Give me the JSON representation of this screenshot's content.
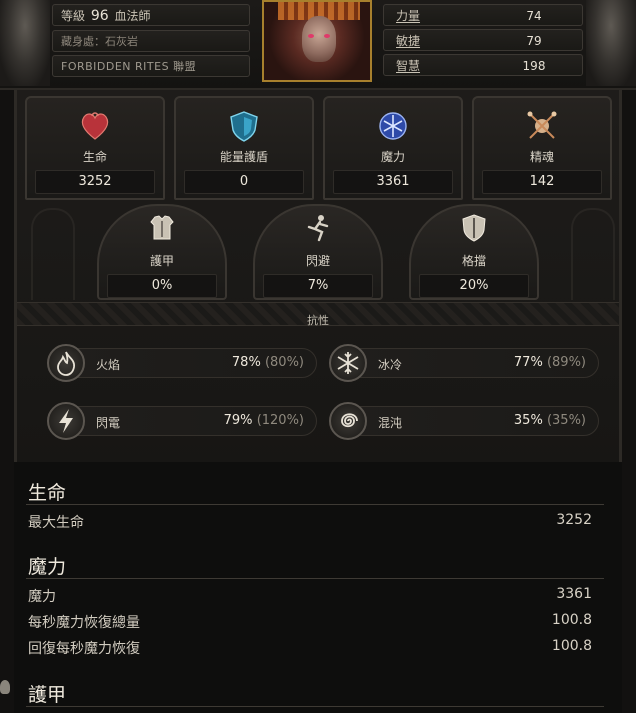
{
  "header": {
    "level_label": "等級",
    "level": "96",
    "class_name": "血法師",
    "stash": "藏身處：石灰岩",
    "guild_name": "FORBIDDEN RITES",
    "guild_suffix": "聯盟",
    "attributes": [
      {
        "label": "力量",
        "value": "74"
      },
      {
        "label": "敏捷",
        "value": "79"
      },
      {
        "label": "智慧",
        "value": "198"
      }
    ]
  },
  "core_stats": [
    {
      "icon": "heart-icon",
      "label": "生命",
      "value": "3252",
      "color": "#c4363a"
    },
    {
      "icon": "shield-icon",
      "label": "能量護盾",
      "value": "0",
      "color": "#3aa4c8"
    },
    {
      "icon": "mana-icon",
      "label": "魔力",
      "value": "3361",
      "color": "#5a7ad8"
    },
    {
      "icon": "spirit-icon",
      "label": "精魂",
      "value": "142",
      "color": "#d6b08a"
    }
  ],
  "defense_stats": [
    {
      "icon": "armour-icon",
      "label": "護甲",
      "value": "0%"
    },
    {
      "icon": "evasion-icon",
      "label": "閃避",
      "value": "7%"
    },
    {
      "icon": "block-icon",
      "label": "格擋",
      "value": "20%"
    }
  ],
  "resistances": {
    "title": "抗性",
    "items": [
      {
        "icon": "fire-icon",
        "label": "火焰",
        "value": "78%",
        "max": "(80%)"
      },
      {
        "icon": "cold-icon",
        "label": "冰冷",
        "value": "77%",
        "max": "(89%)"
      },
      {
        "icon": "lightning-icon",
        "label": "閃電",
        "value": "79%",
        "max": "(120%)"
      },
      {
        "icon": "chaos-icon",
        "label": "混沌",
        "value": "35%",
        "max": "(35%)"
      }
    ]
  },
  "details": {
    "life_title": "生命",
    "max_life_label": "最大生命",
    "max_life": "3252",
    "mana_title": "魔力",
    "mana_label": "魔力",
    "mana": "3361",
    "regen_total_label": "每秒魔力恢復總量",
    "regen_total": "100.8",
    "regen_label": "回復每秒魔力恢復",
    "regen": "100.8",
    "armour_title": "護甲"
  }
}
